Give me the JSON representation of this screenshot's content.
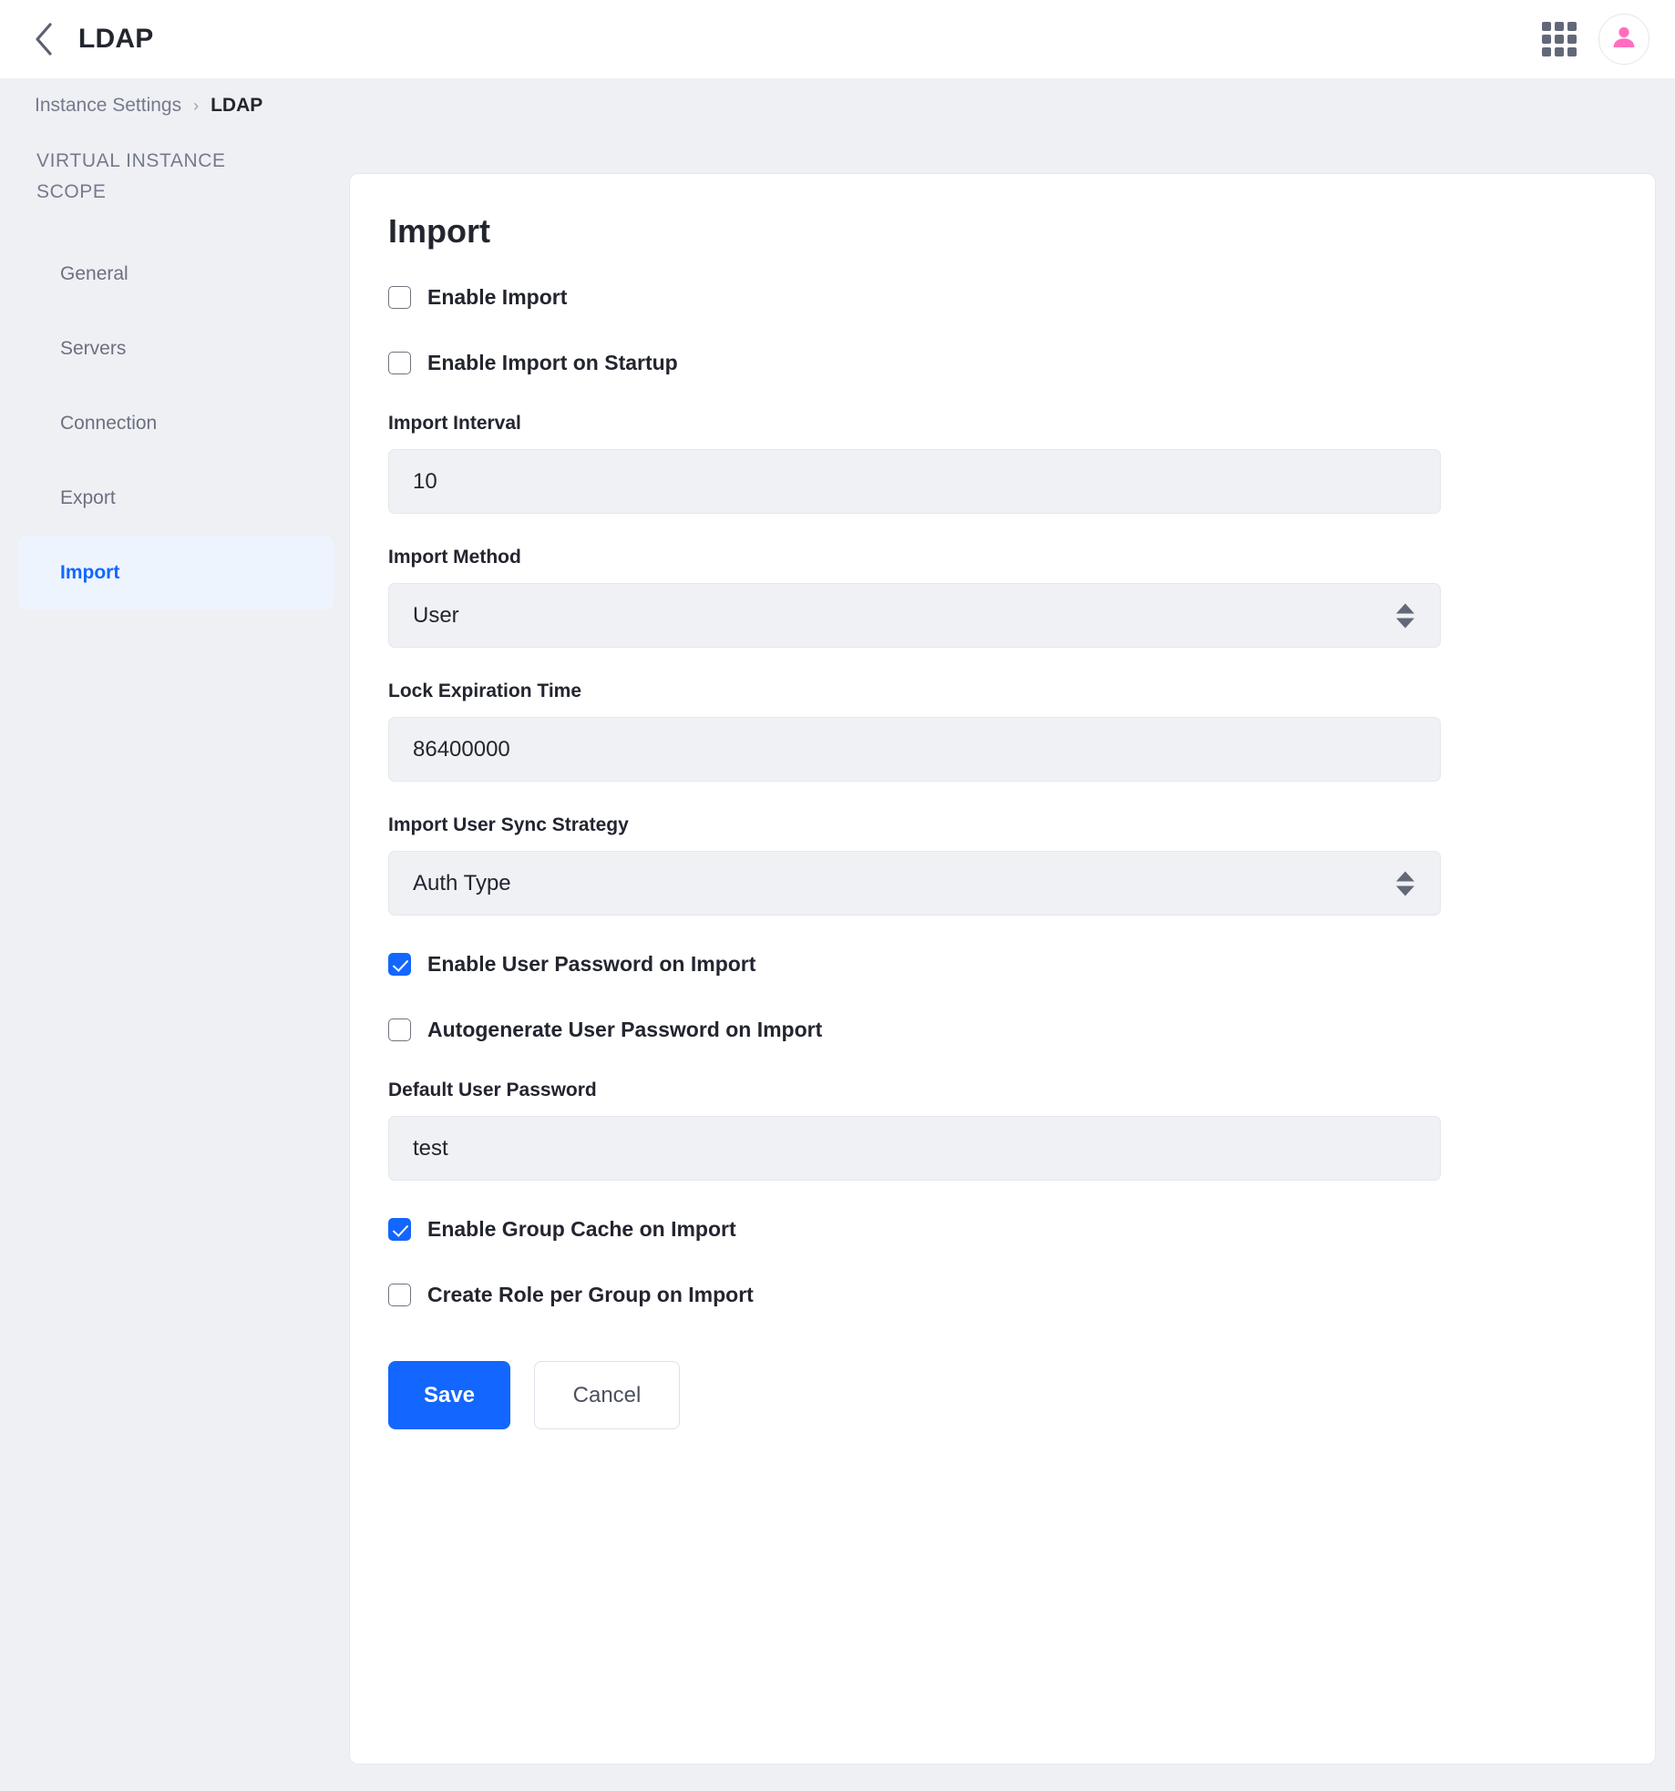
{
  "topbar": {
    "back_icon": "chevron-left-icon",
    "title": "LDAP",
    "apps_icon": "grid-apps-icon",
    "avatar_icon": "user-avatar-icon",
    "avatar_color": "#ff6fbd"
  },
  "breadcrumb": {
    "parent": "Instance Settings",
    "separator": "›",
    "current": "LDAP"
  },
  "sidebar": {
    "scope_title": "VIRTUAL INSTANCE SCOPE",
    "items": [
      {
        "label": "General",
        "active": false
      },
      {
        "label": "Servers",
        "active": false
      },
      {
        "label": "Connection",
        "active": false
      },
      {
        "label": "Export",
        "active": false
      },
      {
        "label": "Import",
        "active": true
      }
    ],
    "active_color": "#1366ff"
  },
  "card": {
    "title": "Import",
    "fields": [
      {
        "type": "checkbox",
        "label": "Enable Import",
        "checked": false
      },
      {
        "type": "checkbox",
        "label": "Enable Import on Startup",
        "checked": false
      },
      {
        "type": "text",
        "label": "Import Interval",
        "value": "10"
      },
      {
        "type": "select",
        "label": "Import Method",
        "value": "User"
      },
      {
        "type": "text",
        "label": "Lock Expiration Time",
        "value": "86400000"
      },
      {
        "type": "select",
        "label": "Import User Sync Strategy",
        "value": "Auth Type"
      },
      {
        "type": "checkbox",
        "label": "Enable User Password on Import",
        "checked": true
      },
      {
        "type": "checkbox",
        "label": "Autogenerate User Password on Import",
        "checked": false
      },
      {
        "type": "text",
        "label": "Default User Password",
        "value": "test"
      },
      {
        "type": "checkbox",
        "label": "Enable Group Cache on Import",
        "checked": true
      },
      {
        "type": "checkbox",
        "label": "Create Role per Group on Import",
        "checked": false
      }
    ],
    "save_label": "Save",
    "cancel_label": "Cancel",
    "primary_color": "#1366ff"
  }
}
